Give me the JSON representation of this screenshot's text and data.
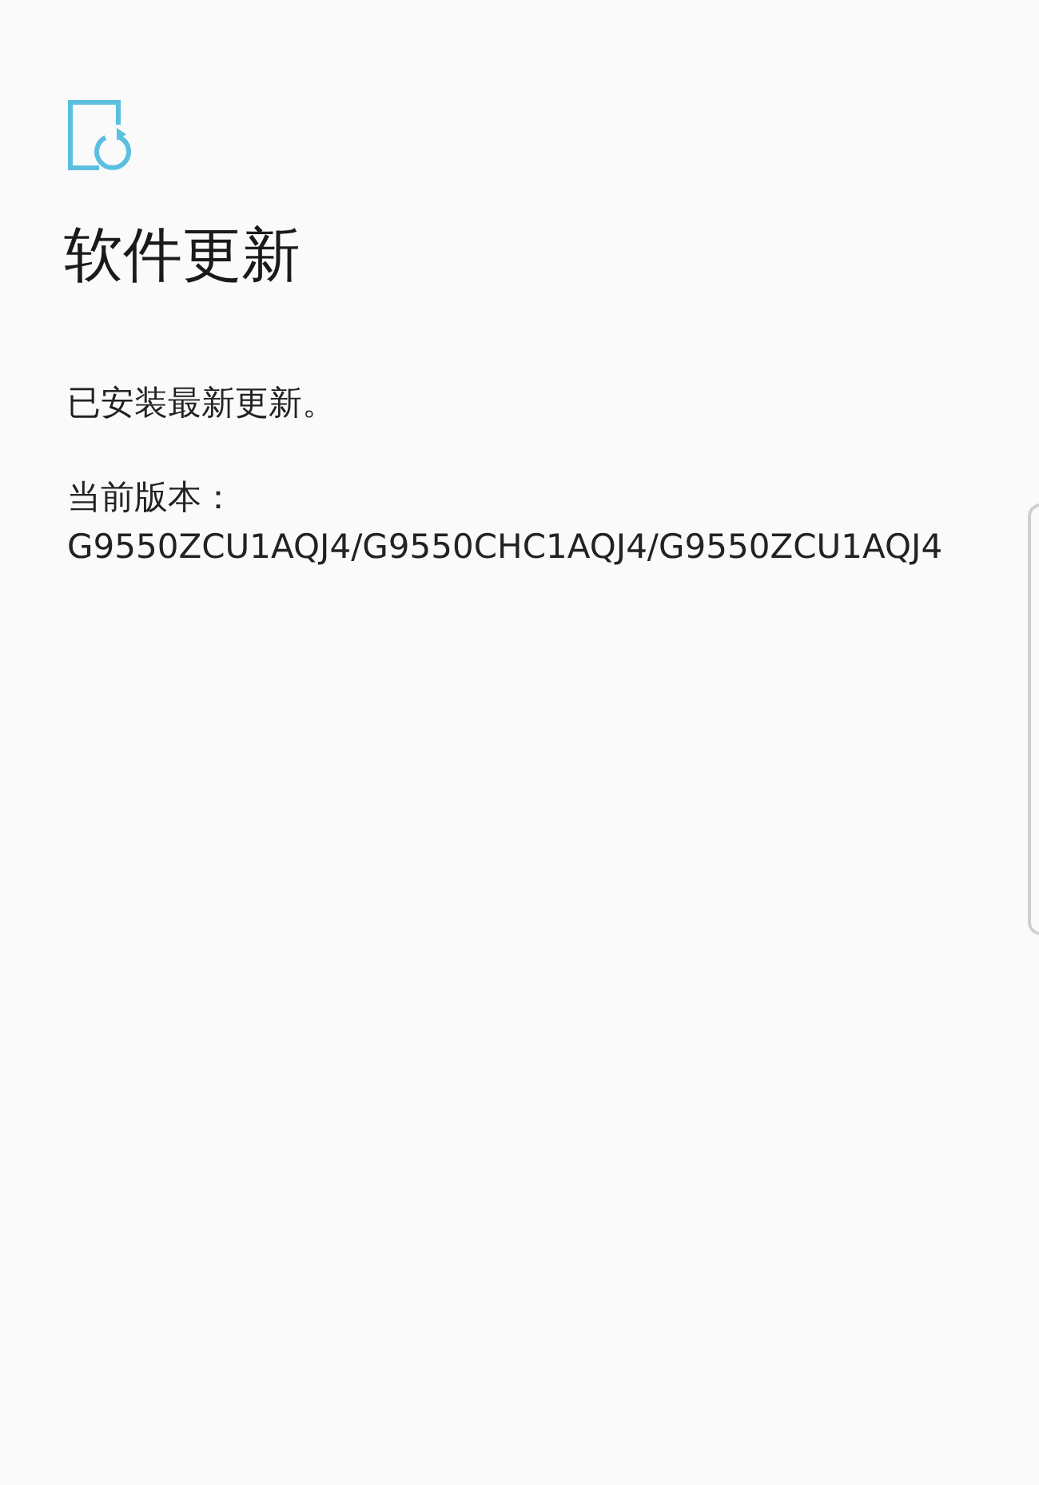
{
  "title": "软件更新",
  "status": "已安装最新更新。",
  "version": "当前版本：G9550ZCU1AQJ4/G9550CHC1AQJ4/G9550ZCU1AQJ4"
}
